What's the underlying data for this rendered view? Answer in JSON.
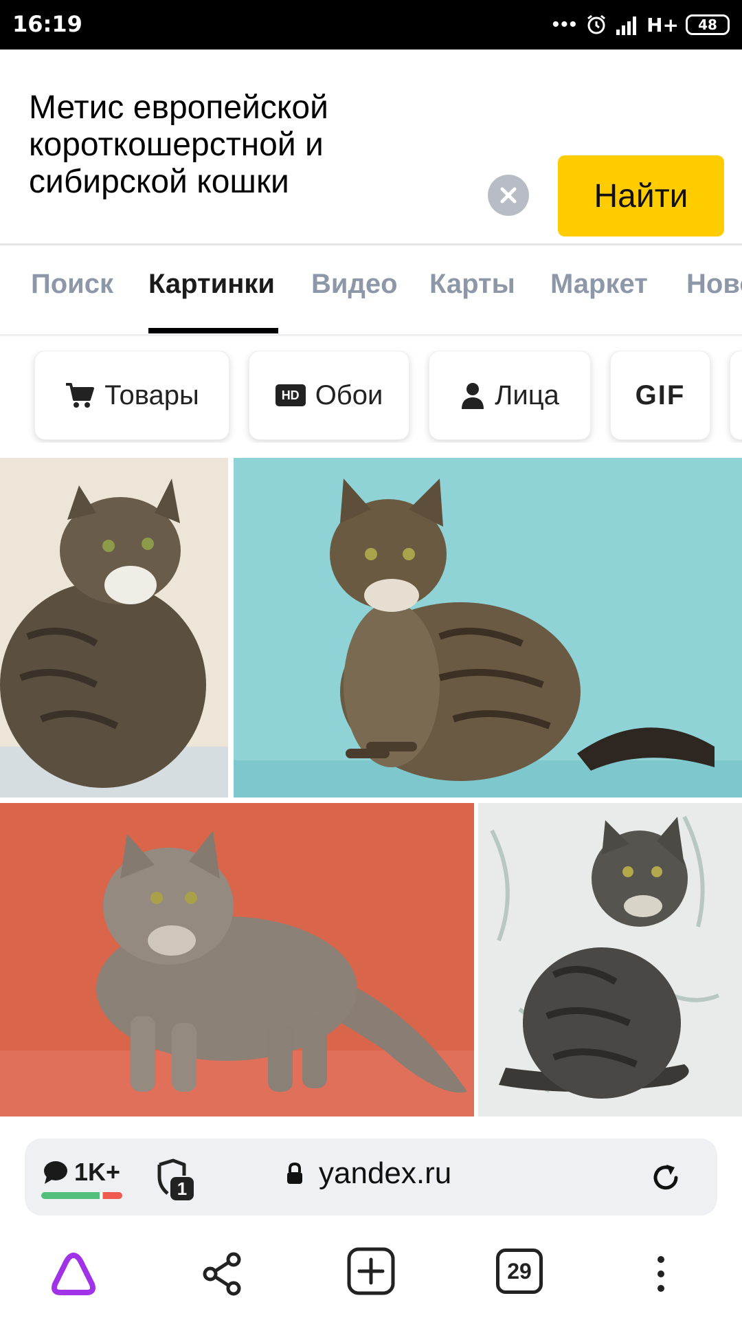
{
  "status_bar": {
    "time": "16:19",
    "network": "H+",
    "battery": "48",
    "icons": [
      "more-dots-icon",
      "alarm-icon",
      "signal-icon",
      "battery-icon"
    ]
  },
  "search": {
    "query": "Метис европейской короткошерстной и сибирской кошки",
    "find_label": "Найти",
    "colors": {
      "find_button": "#ffcc00"
    }
  },
  "tabs": [
    {
      "label": "Поиск",
      "active": false
    },
    {
      "label": "Картинки",
      "active": true
    },
    {
      "label": "Видео",
      "active": false
    },
    {
      "label": "Карты",
      "active": false
    },
    {
      "label": "Маркет",
      "active": false
    },
    {
      "label": "Ново",
      "active": false
    }
  ],
  "chips": [
    {
      "label": "Товары",
      "icon": "cart-icon"
    },
    {
      "label": "Обои",
      "icon": "hd-icon"
    },
    {
      "label": "Лица",
      "icon": "person-icon"
    },
    {
      "label": "GIF",
      "icon": ""
    }
  ],
  "images": [
    {
      "subject": "long-haired tabby cat, cream background"
    },
    {
      "subject": "long-haired tabby cat, turquoise background"
    },
    {
      "subject": "grey fluffy cat standing, orange background"
    },
    {
      "subject": "grey tabby cat sitting, marble background"
    }
  ],
  "browser": {
    "comments_count": "1K+",
    "shield_badge": "1",
    "url": "yandex.ru",
    "tabs_count": "29",
    "icons": [
      "alice-icon",
      "share-icon",
      "new-tab-icon",
      "tabs-icon",
      "menu-icon"
    ]
  }
}
